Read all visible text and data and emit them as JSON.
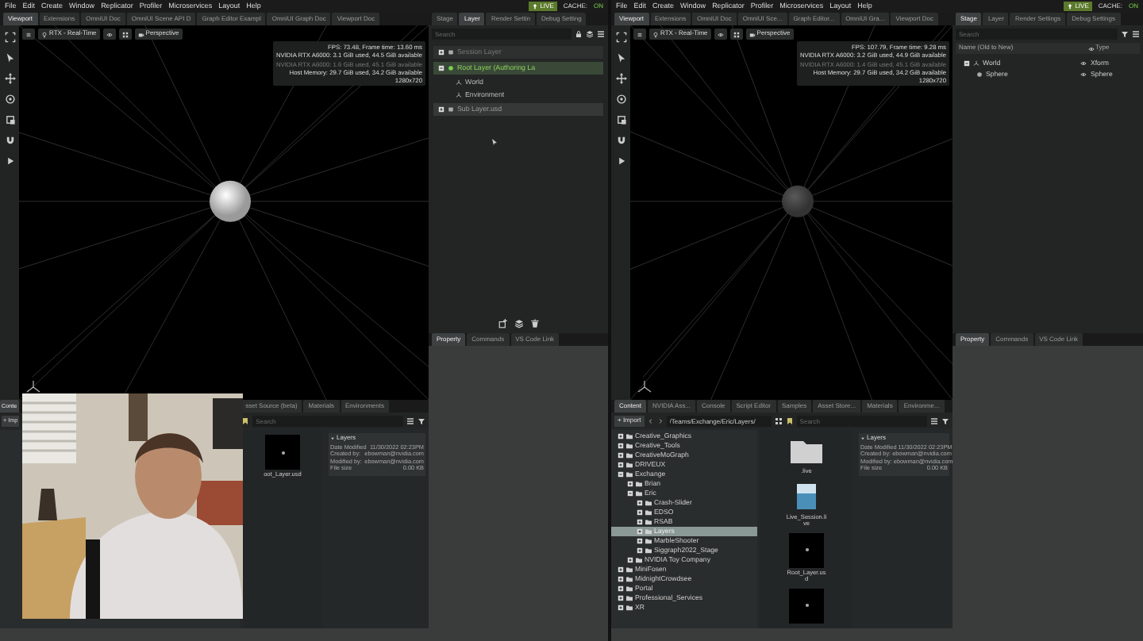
{
  "windows": [
    {
      "menu": [
        "File",
        "Edit",
        "Create",
        "Window",
        "Replicator",
        "Profiler",
        "Microservices",
        "Layout",
        "Help"
      ],
      "live": {
        "label": "LIVE",
        "on": true
      },
      "cache": {
        "label": "CACHE:",
        "value": "ON",
        "on": true
      },
      "viewport_tabs": [
        {
          "label": "Viewport",
          "selected": true
        },
        {
          "label": "Extensions",
          "selected": false
        },
        {
          "label": "OmniUI Doc",
          "selected": false
        },
        {
          "label": "OmniUI Scene API D",
          "selected": false
        },
        {
          "label": "Graph Editor Exampl",
          "selected": false
        },
        {
          "label": "OmniUI Graph Doc",
          "selected": false
        },
        {
          "label": "Viewport Doc",
          "selected": false
        }
      ],
      "viewport": {
        "renderer": "RTX - Real-Time",
        "camera": "Perspective",
        "sphere_lit": true,
        "stats": [
          {
            "text": "FPS: 73.48, Frame time: 13.60 ms",
            "dim": false
          },
          {
            "text": "NVIDIA RTX A6000: 3.1 GiB used, 44.5 GiB available",
            "dim": false
          },
          {
            "text": "NVIDIA RTX A6000: 1.6 GiB used, 45.1 GiB available",
            "dim": true
          },
          {
            "text": "Host Memory: 29.7 GiB used, 34.2 GiB available",
            "dim": false
          },
          {
            "text": "1280x720",
            "dim": false
          }
        ]
      },
      "panel_tabs": [
        {
          "label": "Stage",
          "selected": false
        },
        {
          "label": "Layer",
          "selected": true
        },
        {
          "label": "Render Settin",
          "selected": false
        },
        {
          "label": "Debug Setting",
          "selected": false
        }
      ],
      "panel": {
        "kind": "layer",
        "search": {
          "placeholder": "Search"
        },
        "layers": [
          {
            "name": "Session Layer",
            "kind": "session"
          },
          {
            "name": "Root Layer (Authoring La",
            "kind": "root",
            "children": [
              {
                "name": "World",
                "kind": "prim"
              },
              {
                "name": "Environment",
                "kind": "prim"
              }
            ]
          },
          {
            "name": "Sub Layer.usd",
            "kind": "sublayer"
          }
        ]
      },
      "property_tabs": [
        {
          "label": "Property",
          "selected": true
        },
        {
          "label": "Commands",
          "selected": false
        },
        {
          "label": "VS Code Link",
          "selected": false
        }
      ],
      "content": {
        "tabs": [
          {
            "label": "Conte",
            "selected": true
          },
          {
            "label": "sset Source (beta)",
            "selected": false
          },
          {
            "label": "Materials",
            "selected": false
          },
          {
            "label": "Environments",
            "selected": false
          }
        ],
        "import": "+ Imp",
        "search": {
          "placeholder": "Search"
        },
        "files": [
          {
            "name": "oot_Layer.usd",
            "kind": "usd"
          }
        ],
        "info": {
          "title": "Layers",
          "rows": [
            {
              "label": "Date Modified",
              "value": "11/30/2022 02:23PM"
            },
            {
              "label": "Created by:",
              "value": "ebowman@nvidia.com"
            },
            {
              "label": "Modified by:",
              "value": "ebowman@nvidia.com"
            },
            {
              "label": "File size",
              "value": "0.00 KB"
            }
          ]
        }
      },
      "webcam": {
        "kind": "picture"
      }
    },
    {
      "menu": [
        "File",
        "Edit",
        "Create",
        "Window",
        "Replicator",
        "Profiler",
        "Microservices",
        "Layout",
        "Help"
      ],
      "live": {
        "label": "LIVE",
        "on": true
      },
      "cache": {
        "label": "CACHE:",
        "value": "ON",
        "on": true
      },
      "viewport_tabs": [
        {
          "label": "Viewport",
          "selected": true
        },
        {
          "label": "Extensions",
          "selected": false
        },
        {
          "label": "OmniUI Doc",
          "selected": false
        },
        {
          "label": "OmniUI Sce...",
          "selected": false
        },
        {
          "label": "Graph Editor...",
          "selected": false
        },
        {
          "label": "OmniUI Gra...",
          "selected": false
        },
        {
          "label": "Viewport Doc",
          "selected": false
        }
      ],
      "viewport": {
        "renderer": "RTX - Real-Time",
        "camera": "Perspective",
        "sphere_lit": false,
        "stats": [
          {
            "text": "FPS: 107.79, Frame time: 9.28 ms",
            "dim": false
          },
          {
            "text": "NVIDIA RTX A6000: 3.2 GiB used, 44.9 GiB available",
            "dim": false
          },
          {
            "text": "NVIDIA RTX A6000: 1.4 GiB used, 45.1 GiB available",
            "dim": true
          },
          {
            "text": "Host Memory: 29.7 GiB used, 34.2 GiB available",
            "dim": false
          },
          {
            "text": "1280x720",
            "dim": false
          }
        ]
      },
      "panel_tabs": [
        {
          "label": "Stage",
          "selected": true
        },
        {
          "label": "Layer",
          "selected": false
        },
        {
          "label": "Render Settings",
          "selected": false
        },
        {
          "label": "Debug Settings",
          "selected": false
        }
      ],
      "panel": {
        "kind": "stage",
        "search": {
          "placeholder": "Search"
        },
        "columns": [
          "Name (Old to New)",
          "Type"
        ],
        "prims": [
          {
            "name": "World",
            "type": "Xform",
            "expanded": true,
            "children": [
              {
                "name": "Sphere",
                "type": "Sphere"
              }
            ]
          }
        ]
      },
      "property_tabs": [
        {
          "label": "Property",
          "selected": true
        },
        {
          "label": "Commands",
          "selected": false
        },
        {
          "label": "VS Code Link",
          "selected": false
        }
      ],
      "content": {
        "tabs": [
          {
            "label": "Content",
            "selected": true
          },
          {
            "label": "NVIDIA Ass...",
            "selected": false
          },
          {
            "label": "Console",
            "selected": false
          },
          {
            "label": "Script Editor",
            "selected": false
          },
          {
            "label": "Samples",
            "selected": false
          },
          {
            "label": "Asset Store...",
            "selected": false
          },
          {
            "label": "Materials",
            "selected": false
          },
          {
            "label": "Environme...",
            "selected": false
          }
        ],
        "import": "+ Import",
        "path": "/Teams/Exchange/Eric/Layers/",
        "search": {
          "placeholder": "Search"
        },
        "tree": [
          {
            "name": "Creative_Graphics",
            "expanded": false,
            "selected": false
          },
          {
            "name": "Creative_Tools",
            "expanded": false,
            "selected": false
          },
          {
            "name": "CreativeMoGraph",
            "expanded": false,
            "selected": false
          },
          {
            "name": "DRIVEUX",
            "expanded": false,
            "selected": false
          },
          {
            "name": "Exchange",
            "expanded": true,
            "selected": false,
            "children": [
              {
                "name": "Brian",
                "expanded": false,
                "selected": false
              },
              {
                "name": "Eric",
                "expanded": true,
                "selected": false,
                "children": [
                  {
                    "name": "Crash-Slider",
                    "expanded": false,
                    "selected": false
                  },
                  {
                    "name": "EDSO",
                    "expanded": false,
                    "selected": false
                  },
                  {
                    "name": "RSAB",
                    "expanded": false,
                    "selected": false
                  },
                  {
                    "name": "Layers",
                    "expanded": false,
                    "selected": true
                  },
                  {
                    "name": "MarbleShooter",
                    "expanded": false,
                    "selected": false
                  },
                  {
                    "name": "Siggraph2022_Stage",
                    "expanded": false,
                    "selected": false
                  }
                ]
              },
              {
                "name": "NVIDIA Toy Company",
                "expanded": false,
                "selected": false
              }
            ]
          },
          {
            "name": "MiniFosen",
            "expanded": false,
            "selected": false
          },
          {
            "name": "MidnightCrowdsee",
            "expanded": false,
            "selected": false
          },
          {
            "name": "Portal",
            "expanded": false,
            "selected": false
          },
          {
            "name": "Professional_Services",
            "expanded": false,
            "selected": false
          },
          {
            "name": "XR",
            "expanded": false,
            "selected": false
          }
        ],
        "files": [
          {
            "name": ".live",
            "kind": "folder"
          },
          {
            "name": "Live_Session.live",
            "kind": "doc"
          },
          {
            "name": "Root_Layer.usd",
            "kind": "usd"
          },
          {
            "kind": "usd"
          }
        ],
        "info": {
          "title": "Layers",
          "rows": [
            {
              "label": "Date Modified",
              "value": "11/30/2022 02:23PM"
            },
            {
              "label": "Created by:",
              "value": "ebowman@nvidia.com"
            },
            {
              "label": "Modified by:",
              "value": "ebowman@nvidia.com"
            },
            {
              "label": "File size",
              "value": "0.00 KB"
            }
          ]
        }
      }
    }
  ]
}
